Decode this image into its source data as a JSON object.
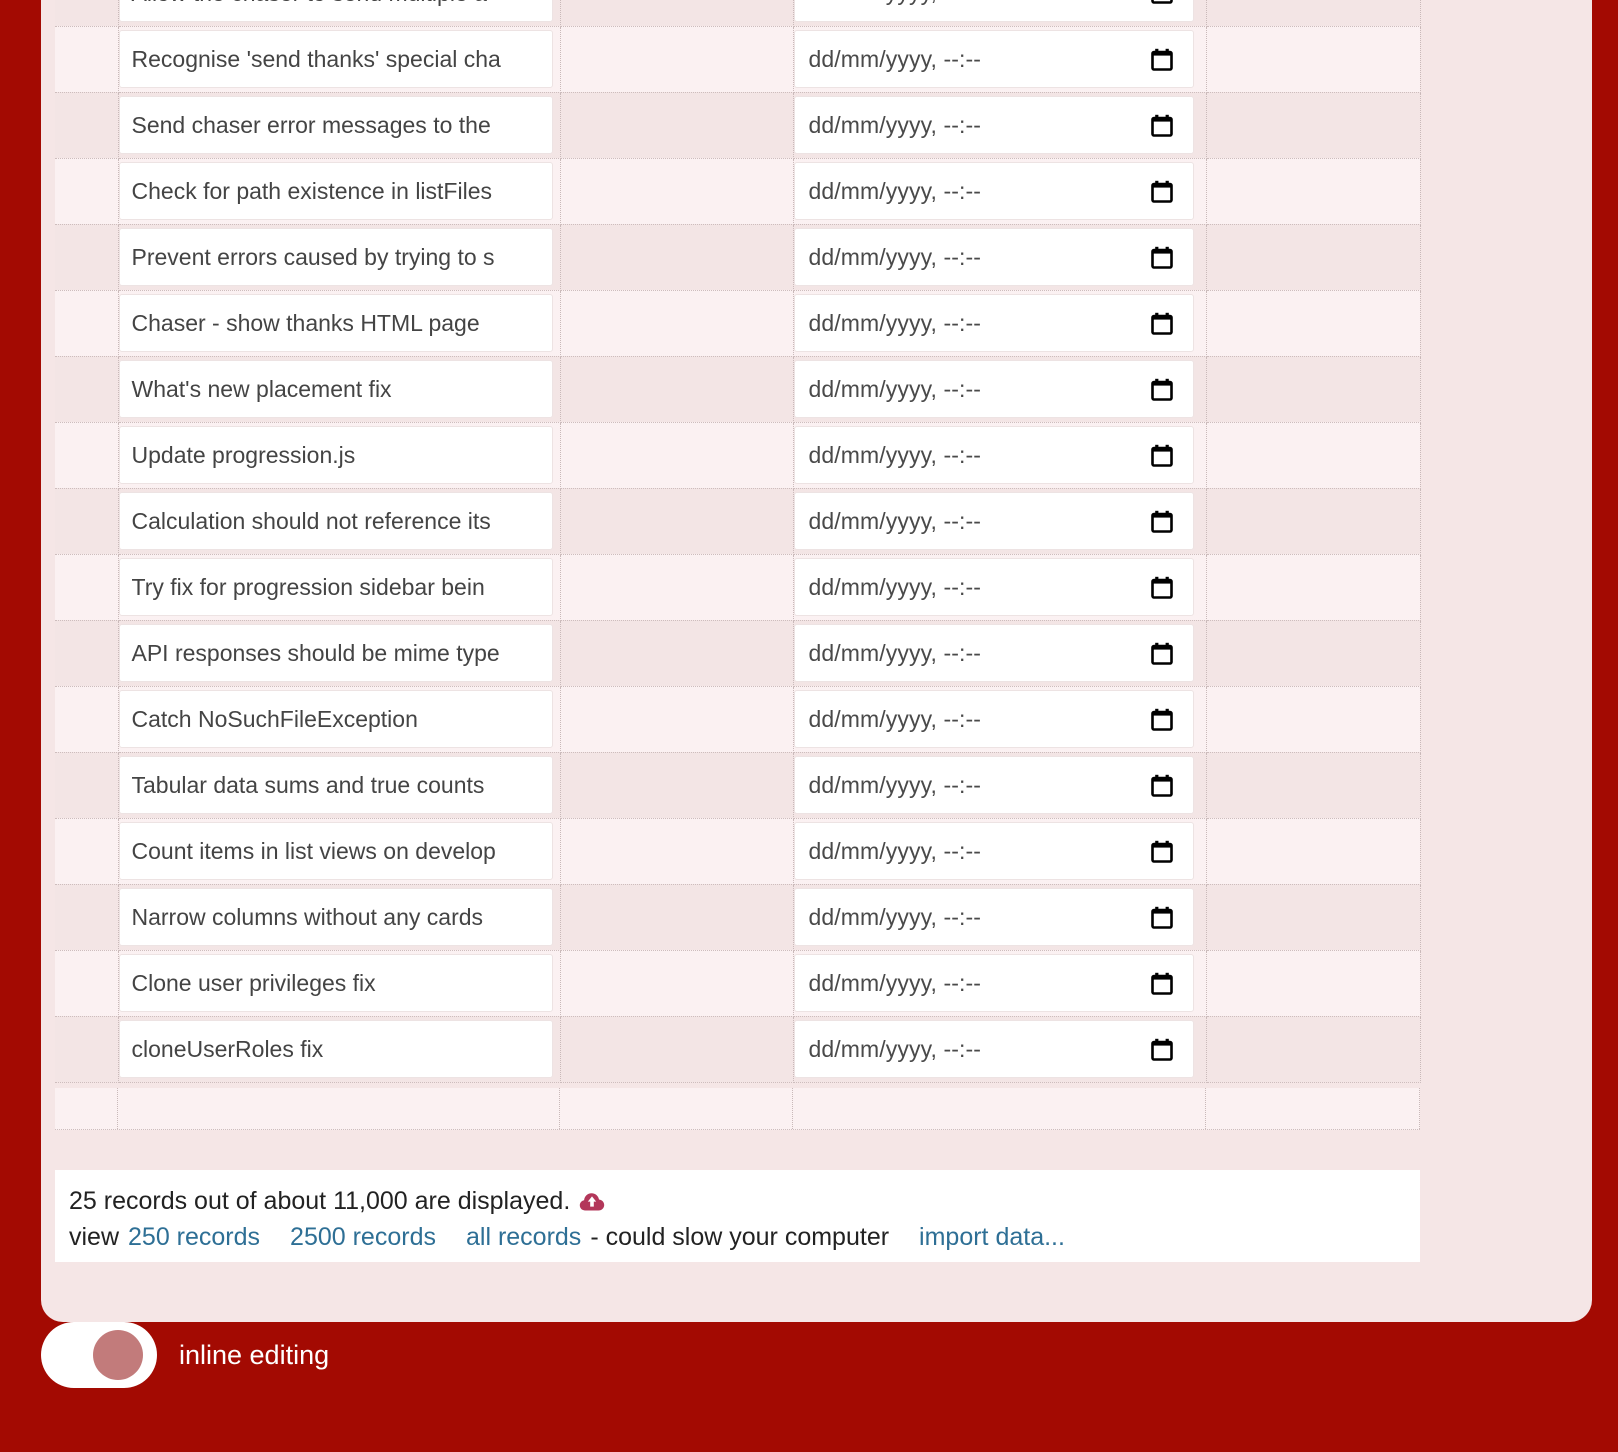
{
  "theme": {
    "page_background": "#a30a02",
    "panel_background": "#f5e6e6",
    "row_odd": "#f3e5e5",
    "row_even": "#fbf1f2",
    "link_color": "#2e6f95",
    "toggle_knob": "#c27b7b",
    "cloud_icon_color": "#b3375a"
  },
  "table": {
    "date_placeholder": "dd/mm/yyyy, --:--",
    "rows": [
      {
        "title": "Allow the chaser to send multiple a",
        "date": ""
      },
      {
        "title": "Recognise 'send thanks' special cha",
        "date": ""
      },
      {
        "title": "Send chaser error messages to the",
        "date": ""
      },
      {
        "title": "Check for path existence in listFiles",
        "date": ""
      },
      {
        "title": "Prevent errors caused by trying to s",
        "date": ""
      },
      {
        "title": "Chaser - show thanks HTML page",
        "date": ""
      },
      {
        "title": "What's new placement fix",
        "date": ""
      },
      {
        "title": "Update progression.js",
        "date": ""
      },
      {
        "title": "Calculation should not reference its",
        "date": ""
      },
      {
        "title": "Try fix for progression sidebar bein",
        "date": ""
      },
      {
        "title": "API responses should be mime type",
        "date": ""
      },
      {
        "title": "Catch NoSuchFileException",
        "date": ""
      },
      {
        "title": "Tabular data sums and true counts",
        "date": ""
      },
      {
        "title": "Count items in list views on develop",
        "date": ""
      },
      {
        "title": "Narrow columns without any cards",
        "date": ""
      },
      {
        "title": "Clone user privileges fix",
        "date": ""
      },
      {
        "title": "cloneUserRoles fix",
        "date": ""
      }
    ]
  },
  "footer": {
    "summary": "25 records out of about 11,000 are displayed.",
    "view_label": "view",
    "links": [
      {
        "label": "250 records"
      },
      {
        "label": "2500 records"
      },
      {
        "label": "all records"
      }
    ],
    "warning": "- could slow your computer",
    "import_label": "import data..."
  },
  "toggle": {
    "label": "inline editing",
    "state": "on"
  }
}
